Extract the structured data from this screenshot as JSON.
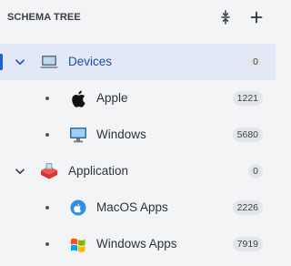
{
  "header": {
    "title": "SCHEMA TREE",
    "collapse_icon": "collapse-all-icon",
    "add_icon": "plus-icon"
  },
  "tree": [
    {
      "label": "Devices",
      "count": "0",
      "icon": "monitor-laptop-icon",
      "expanded": true,
      "selected": true
    },
    {
      "label": "Apple",
      "count": "1221",
      "icon": "apple-logo-icon"
    },
    {
      "label": "Windows",
      "count": "5680",
      "icon": "windows-desktop-icon"
    },
    {
      "label": "Application",
      "count": "0",
      "icon": "application-stack-icon",
      "expanded": true
    },
    {
      "label": "MacOS Apps",
      "count": "2226",
      "icon": "macos-finder-icon"
    },
    {
      "label": "Windows Apps",
      "count": "7919",
      "icon": "windows-flag-icon"
    }
  ],
  "colors": {
    "accent": "#1f5fd1",
    "selected_bg": "#e2e8f5",
    "panel_bg": "#f3f4f6",
    "badge_bg": "#e4e6ea"
  }
}
